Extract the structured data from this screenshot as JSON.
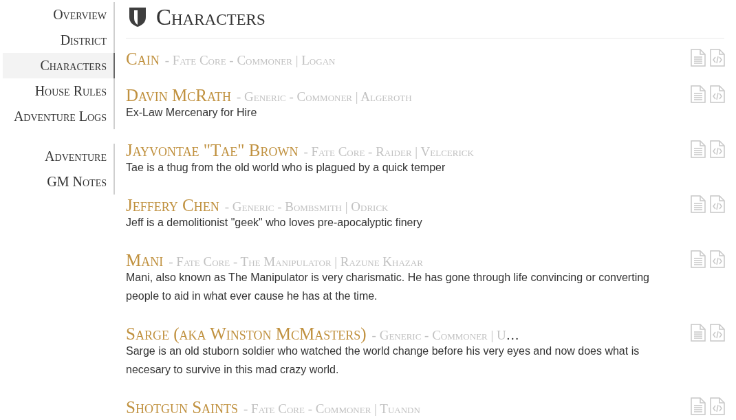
{
  "nav_groups": [
    [
      {
        "label": "Overview",
        "selected": false
      },
      {
        "label": "District",
        "selected": false
      },
      {
        "label": "Characters",
        "selected": true
      },
      {
        "label": "House Rules",
        "selected": false
      },
      {
        "label": "Adventure Logs",
        "selected": false
      }
    ],
    [
      {
        "label": "Adventure",
        "selected": false
      },
      {
        "label": "GM Notes",
        "selected": false
      }
    ]
  ],
  "page_title": "Characters",
  "characters": [
    {
      "name": "Cain",
      "meta": "- Fate Core - Commoner | Logan"
    },
    {
      "name": "Davin McRath",
      "meta": "- Generic - Commoner | Algeroth",
      "description": "Ex-Law Mercenary for Hire"
    },
    {
      "name": "Jayvontae \"Tae\" Brown",
      "meta": "- Fate Core - Raider | Velcerick",
      "description": "Tae is a thug from the old world who is plagued by a quick temper"
    },
    {
      "name": "Jeffery Chen",
      "meta": "- Generic - Bombsmith | Odrick",
      "description": "Jeff is a demolitionist \"geek\" who loves pre-apocalyptic finery"
    },
    {
      "name": "Mani",
      "meta": "- Fate Core - The Manipulator | Razune Khazar",
      "description": "Mani, also known as The Manipulator is very charismatic. He has gone through life convincing or converting people to aid in what ever cause he has at the time."
    },
    {
      "name": "Sarge (aka Winston McMasters)",
      "meta": "- Generic - Commoner | U",
      "meta_ellipsis": "…",
      "description": "Sarge is an old stuborn soldier who watched the world change before his very eyes and now does what is necesary to survive in this mad crazy world."
    },
    {
      "name": "Shotgun Saints",
      "meta": "- Fate Core - Commoner | Tuandn"
    }
  ]
}
